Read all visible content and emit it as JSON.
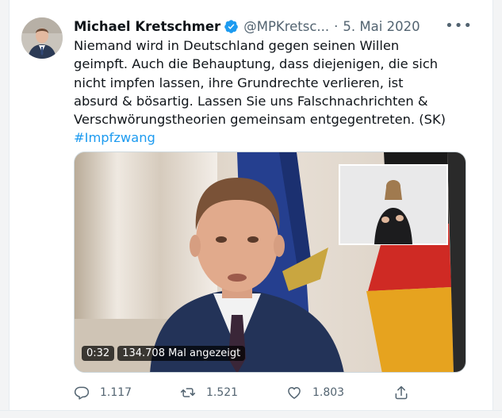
{
  "tweet": {
    "author_name": "Michael Kretschmer",
    "handle": "@MPKretsc...",
    "separator": "·",
    "date": "5. Mai 2020",
    "more": "•••",
    "text_line1": "Niemand wird in Deutschland gegen seinen Willen",
    "text_line2": "geimpft. Auch die Behauptung, dass diejenigen, die sich",
    "text_line3": "nicht impfen lassen, ihre Grundrechte verlieren, ist",
    "text_line4": "absurd & bösartig. Lassen Sie uns Falschnachrichten &",
    "text_line5": "Verschwörungstheorien  gemeinsam entgegentreten. (SK)",
    "hashtag": "#Impfzwang"
  },
  "video": {
    "duration": "0:32",
    "views": "134.708 Mal angezeigt"
  },
  "actions": {
    "replies": "1.117",
    "retweets": "1.521",
    "likes": "1.803"
  },
  "icons": {
    "verified": "verified-badge-icon",
    "reply": "reply-icon",
    "retweet": "retweet-icon",
    "like": "heart-icon",
    "share": "share-icon"
  },
  "colors": {
    "accent": "#1d9bf0",
    "secondary_text": "#536471",
    "primary_text": "#0f1419"
  }
}
